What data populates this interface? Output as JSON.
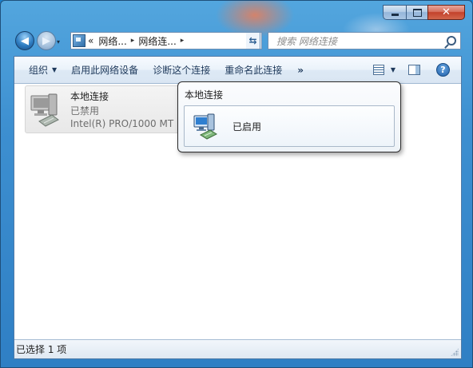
{
  "titlebar": {
    "minimize_icon": "minimize-icon",
    "maximize_icon": "maximize-icon",
    "close_icon": "close-icon",
    "close_glyph": "✕"
  },
  "nav": {
    "back_glyph": "◀",
    "forward_glyph": "▶",
    "history_glyph": "▾"
  },
  "address": {
    "prefix": "«",
    "crumbs": [
      "网络...",
      "网络连..."
    ],
    "separator": "▸",
    "dropdown_glyph": "▼",
    "refresh_glyph": "⇆"
  },
  "search": {
    "placeholder": "搜索 网络连接"
  },
  "toolbar": {
    "organize": "组织",
    "enable_device": "启用此网络设备",
    "diagnose": "诊断这个连接",
    "rename": "重命名此连接",
    "more": "»",
    "dropdown_glyph": "▼",
    "help_glyph": "?"
  },
  "connection": {
    "name": "本地连接",
    "status": "已禁用",
    "device": "Intel(R) PRO/1000 MT N..."
  },
  "popup": {
    "title": "本地连接",
    "option_label": "已启用"
  },
  "statusbar": {
    "selection_text": "已选择 1 项"
  },
  "colors": {
    "glass": "#3d8fd0",
    "close_button": "#c2412b",
    "toolbar_text": "#1e395b",
    "disabled_text": "#6d6d6d"
  }
}
